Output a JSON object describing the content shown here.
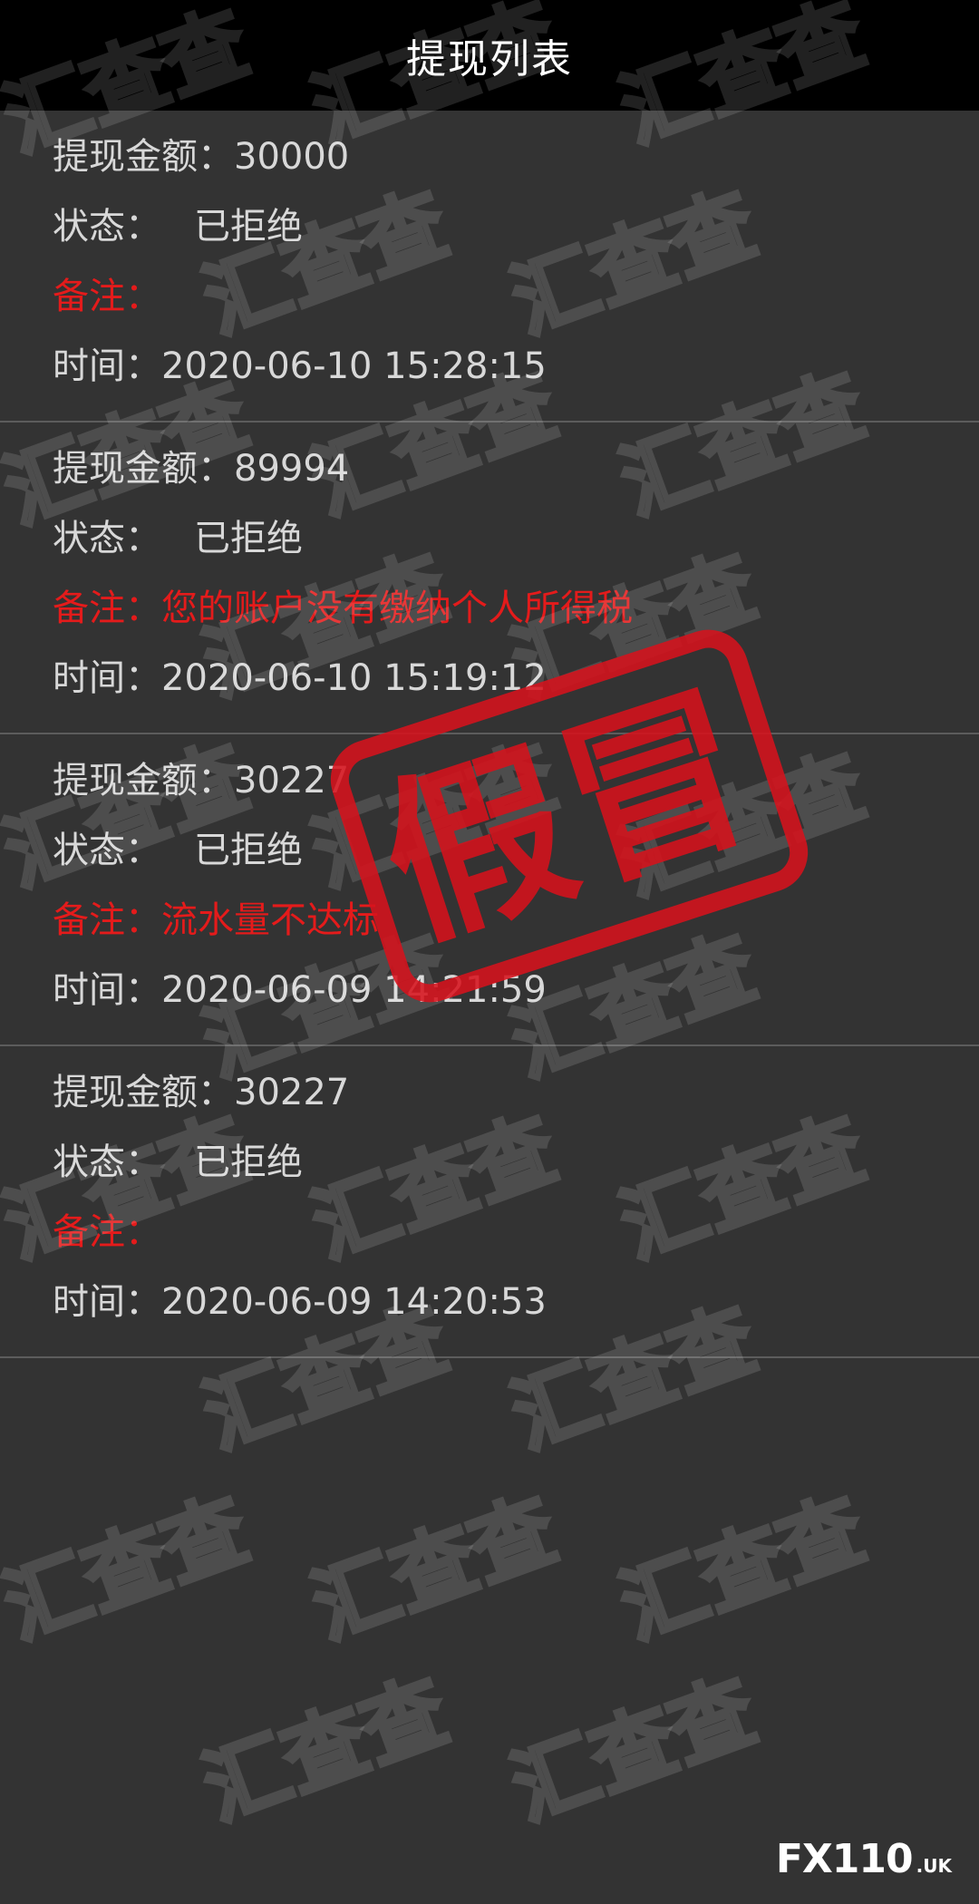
{
  "header": {
    "title": "提现列表"
  },
  "labels": {
    "amount": "提现金额：",
    "status": "状态：",
    "note": "备注：",
    "time": "时间："
  },
  "records": [
    {
      "amount": "30000",
      "status": "已拒绝",
      "note": "",
      "time": "2020-06-10 15:28:15"
    },
    {
      "amount": "89994",
      "status": "已拒绝",
      "note": "您的账户没有缴纳个人所得税",
      "time": "2020-06-10 15:19:12"
    },
    {
      "amount": "30227",
      "status": "已拒绝",
      "note": "流水量不达标",
      "time": "2020-06-09 14:21:59"
    },
    {
      "amount": "30227",
      "status": "已拒绝",
      "note": "",
      "time": "2020-06-09 14:20:53"
    }
  ],
  "overlay": {
    "stamp_text": "假冒",
    "watermark_text": "汇查查",
    "brand_main": "FX110",
    "brand_suffix": ".UK"
  },
  "colors": {
    "background": "#333333",
    "header": "#000000",
    "note_red": "#e41b1b",
    "stamp_red": "#d6121c"
  }
}
